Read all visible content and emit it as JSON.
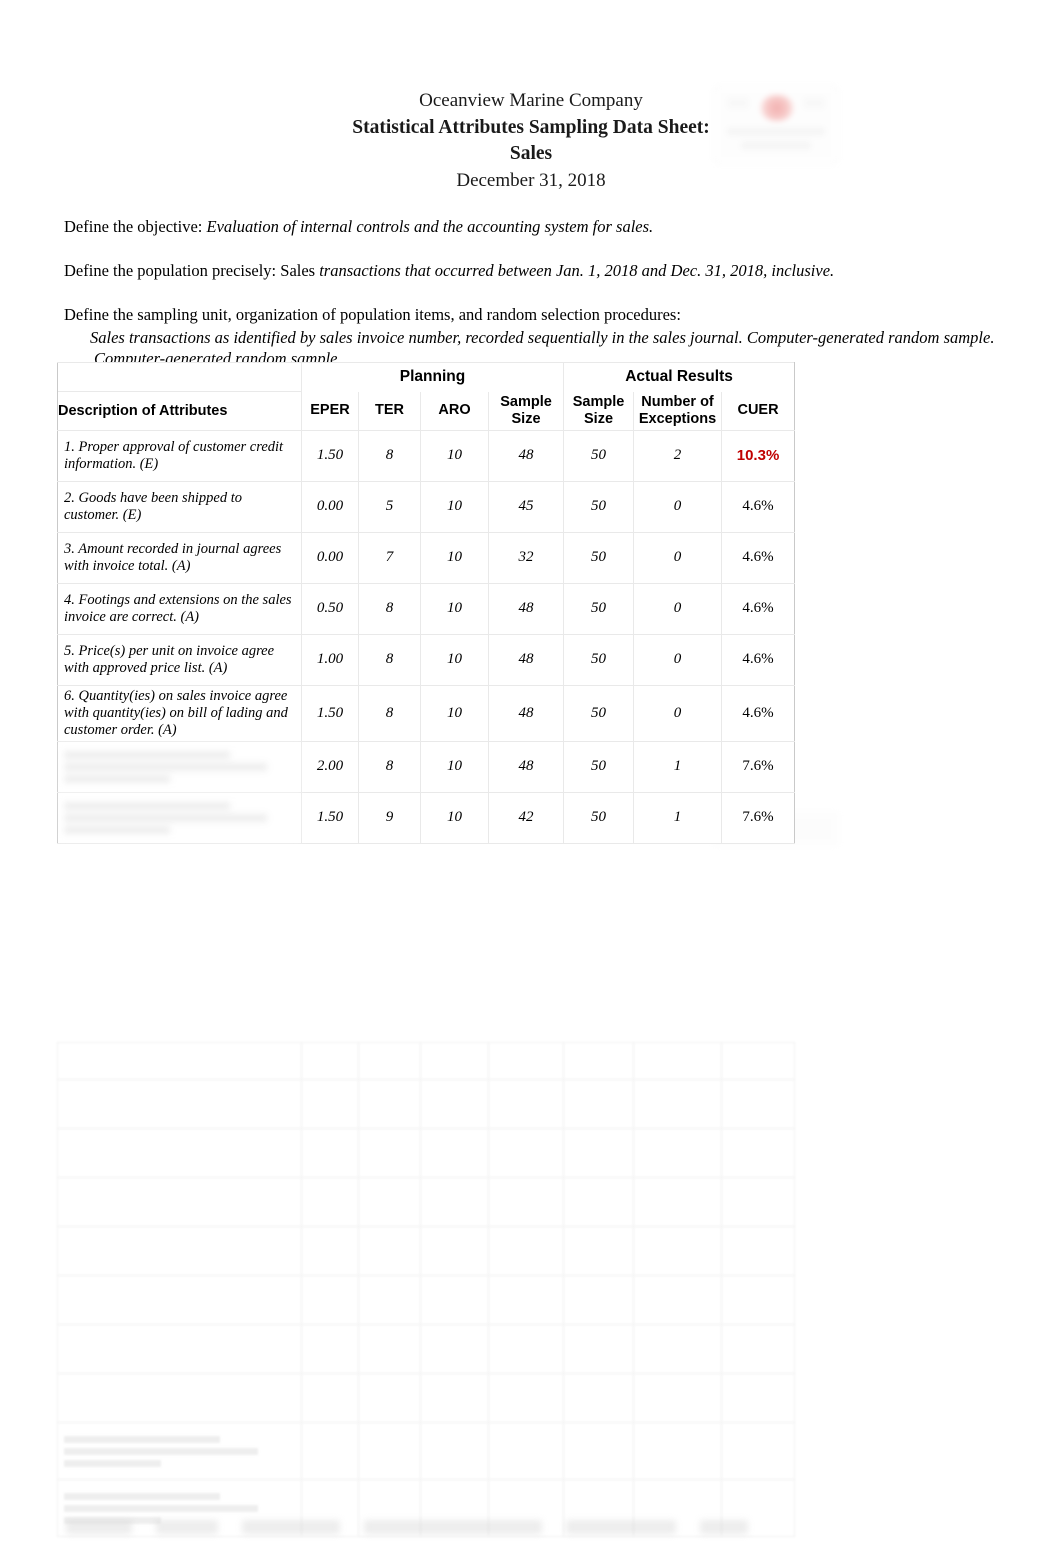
{
  "document": {
    "company": "Oceanview Marine Company",
    "title": "Statistical Attributes Sampling Data Sheet:",
    "subject": "Sales",
    "date": "December 31, 2018"
  },
  "intro": {
    "objective_label": "Define the objective:",
    "objective_value": "Evaluation of internal controls and the accounting system for sales.",
    "population_label": "Define the population precisely: Sales",
    "population_value": "transactions that occurred between Jan. 1, 2018 and Dec. 31, 2018, inclusive.",
    "sampling_unit_label": "Define the sampling unit, organization of population items, and random selection procedures:",
    "sampling_unit_value": "Sales transactions as identified by sales invoice number, recorded sequentially in the sales journal. Computer-generated random sample.",
    "sampling_unit_value_2": "Computer-generated random sample."
  },
  "table": {
    "group_headers": {
      "blank": "",
      "planning": "Planning",
      "actual_results": "Actual Results"
    },
    "columns": [
      "Description of Attributes",
      "EPER",
      "TER",
      "ARO",
      "Sample Size",
      "Sample Size",
      "Number of Exceptions",
      "CUER"
    ],
    "column_lines": {
      "sample_size_l1": "Sample",
      "sample_size_l2": "Size",
      "exceptions_l1": "Number of",
      "exceptions_l2": "Exceptions"
    },
    "rows": [
      {
        "description": "1. Proper approval of customer credit information. (E)",
        "eper": "1.50",
        "ter": "8",
        "aro": "10",
        "planning_sample_size": "48",
        "actual_sample_size": "50",
        "exceptions": "2",
        "cuer": "10.3%",
        "cuer_alert": true,
        "redacted": false
      },
      {
        "description": "2. Goods have been shipped to customer. (E)",
        "eper": "0.00",
        "ter": "5",
        "aro": "10",
        "planning_sample_size": "45",
        "actual_sample_size": "50",
        "exceptions": "0",
        "cuer": "4.6%",
        "cuer_alert": false,
        "redacted": false
      },
      {
        "description": "3. Amount recorded in journal agrees with invoice total. (A)",
        "eper": "0.00",
        "ter": "7",
        "aro": "10",
        "planning_sample_size": "32",
        "actual_sample_size": "50",
        "exceptions": "0",
        "cuer": "4.6%",
        "cuer_alert": false,
        "redacted": false
      },
      {
        "description": "4. Footings and extensions on the sales invoice are correct. (A)",
        "eper": "0.50",
        "ter": "8",
        "aro": "10",
        "planning_sample_size": "48",
        "actual_sample_size": "50",
        "exceptions": "0",
        "cuer": "4.6%",
        "cuer_alert": false,
        "redacted": false
      },
      {
        "description": "5. Price(s) per unit on invoice agree with approved price list. (A)",
        "eper": "1.00",
        "ter": "8",
        "aro": "10",
        "planning_sample_size": "48",
        "actual_sample_size": "50",
        "exceptions": "0",
        "cuer": "4.6%",
        "cuer_alert": false,
        "redacted": false
      },
      {
        "description": "6. Quantity(ies) on sales invoice agree with quantity(ies) on bill of lading and customer order. (A)",
        "eper": "1.50",
        "ter": "8",
        "aro": "10",
        "planning_sample_size": "48",
        "actual_sample_size": "50",
        "exceptions": "0",
        "cuer": "4.6%",
        "cuer_alert": false,
        "redacted": false
      },
      {
        "description": "",
        "eper": "2.00",
        "ter": "8",
        "aro": "10",
        "planning_sample_size": "48",
        "actual_sample_size": "50",
        "exceptions": "1",
        "cuer": "7.6%",
        "cuer_alert": false,
        "redacted": true
      },
      {
        "description": "",
        "eper": "1.50",
        "ter": "9",
        "aro": "10",
        "planning_sample_size": "42",
        "actual_sample_size": "50",
        "exceptions": "1",
        "cuer": "7.6%",
        "cuer_alert": false,
        "redacted": true
      }
    ]
  },
  "colors": {
    "alert": "#c00000",
    "text": "#000000",
    "grid": "#e9e9e9",
    "logo_accent": "#e8706e"
  },
  "footer": {
    "tab_widths": [
      66,
      62,
      98,
      178,
      110,
      48
    ]
  }
}
